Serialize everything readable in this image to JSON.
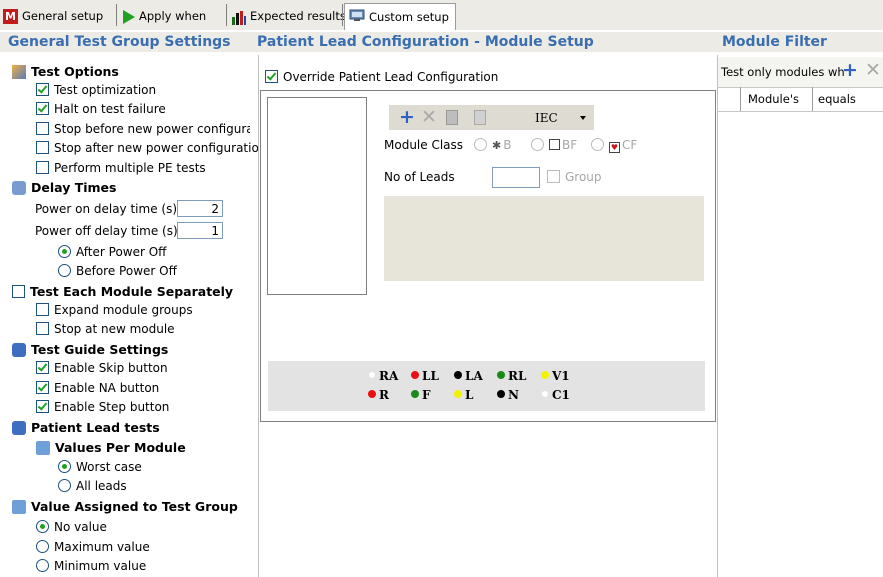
{
  "tabs": [
    {
      "label": "General setup",
      "icon": "m-logo-icon"
    },
    {
      "label": "Apply when",
      "icon": "play-arrow-icon"
    },
    {
      "label": "Expected results",
      "icon": "bar-chart-icon"
    },
    {
      "label": "Custom setup",
      "icon": "monitor-icon"
    }
  ],
  "headers": {
    "left": "General Test Group Settings",
    "middle": "Patient Lead Configuration - Module Setup",
    "right": "Module Filter"
  },
  "left": {
    "test_options": {
      "title": "Test Options",
      "items": [
        {
          "label": "Test optimization",
          "checked": true
        },
        {
          "label": "Halt on test failure",
          "checked": true
        },
        {
          "label": "Stop before new power configuration",
          "checked": false
        },
        {
          "label": "Stop after new power configuration",
          "checked": false
        },
        {
          "label": "Perform multiple PE tests",
          "checked": false
        }
      ]
    },
    "delay_times": {
      "title": "Delay Times",
      "power_on_label": "Power on delay time (s)",
      "power_on_value": "2",
      "power_off_label": "Power off delay time (s)",
      "power_off_value": "1",
      "options": [
        {
          "label": "After Power Off",
          "selected": true
        },
        {
          "label": "Before Power Off",
          "selected": false
        }
      ]
    },
    "separately": {
      "title": "Test Each Module Separately",
      "checked": false,
      "items": [
        {
          "label": "Expand module groups",
          "checked": false
        },
        {
          "label": "Stop at new module",
          "checked": false
        }
      ]
    },
    "guide": {
      "title": "Test Guide Settings",
      "items": [
        {
          "label": "Enable Skip button",
          "checked": true
        },
        {
          "label": "Enable NA button",
          "checked": true
        },
        {
          "label": "Enable Step button",
          "checked": true
        }
      ]
    },
    "patient_lead_tests": {
      "title": "Patient Lead tests",
      "sub_title": "Values Per Module",
      "options": [
        {
          "label": "Worst case",
          "selected": true
        },
        {
          "label": "All leads",
          "selected": false
        }
      ]
    },
    "assigned": {
      "title": "Value Assigned to Test Group",
      "options": [
        {
          "label": "No value",
          "selected": true
        },
        {
          "label": "Maximum value",
          "selected": false
        },
        {
          "label": "Minimum value",
          "selected": false
        }
      ]
    }
  },
  "middle": {
    "override_label": "Override Patient Lead Configuration",
    "override_checked": true,
    "standard_select": "IEC",
    "module_class_label": "Module Class",
    "class_options": [
      {
        "label": "B"
      },
      {
        "label": "BF"
      },
      {
        "label": "CF"
      }
    ],
    "leads_label": "No of Leads",
    "group_label": "Group",
    "leads_row1": [
      {
        "label": "RA",
        "color": "#ffffff"
      },
      {
        "label": "LL",
        "color": "#e81010"
      },
      {
        "label": "LA",
        "color": "#000000"
      },
      {
        "label": "RL",
        "color": "#1a8a1a"
      },
      {
        "label": "V1",
        "color": "#f2f200"
      }
    ],
    "leads_row2": [
      {
        "label": "R",
        "color": "#e81010"
      },
      {
        "label": "F",
        "color": "#1a8a1a"
      },
      {
        "label": "L",
        "color": "#f2f200"
      },
      {
        "label": "N",
        "color": "#000000"
      },
      {
        "label": "C1",
        "color": "#ffffff"
      }
    ]
  },
  "right": {
    "filter_text": "Test only modules wh",
    "col1": "Module's",
    "col2": "equals"
  }
}
